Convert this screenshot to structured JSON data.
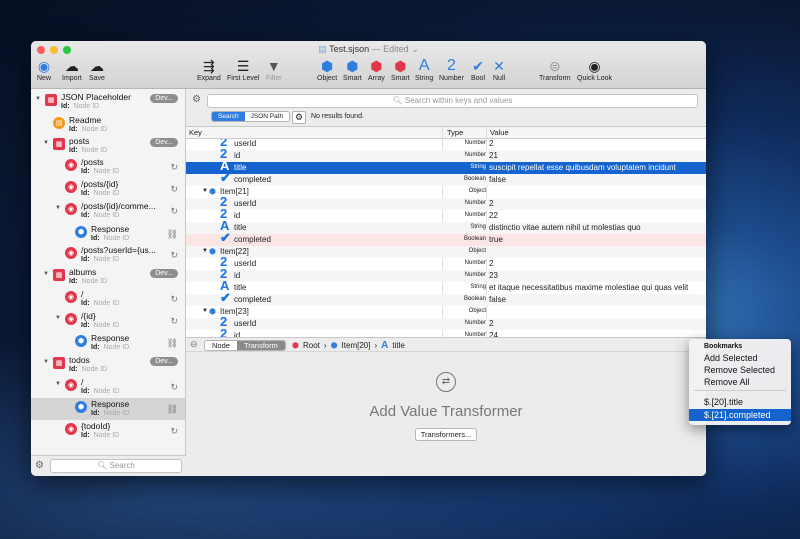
{
  "window": {
    "title": "Test.sjson",
    "status": "— Edited ⌄"
  },
  "toolbar": {
    "left": [
      {
        "label": "New",
        "icon": "new-icon"
      },
      {
        "label": "Import",
        "icon": "import-icon"
      },
      {
        "label": "Save",
        "icon": "save-icon"
      }
    ],
    "mid": [
      {
        "label": "Expand",
        "icon": "expand-icon"
      },
      {
        "label": "First Level",
        "icon": "first-level-icon"
      },
      {
        "label": "Filter",
        "icon": "filter-icon"
      }
    ],
    "types": [
      {
        "label": "Object"
      },
      {
        "label": "Smart"
      },
      {
        "label": "Array"
      },
      {
        "label": "Smart"
      },
      {
        "label": "String"
      },
      {
        "label": "Number"
      },
      {
        "label": "Bool"
      },
      {
        "label": "Null"
      }
    ],
    "right": [
      {
        "label": "Transform"
      },
      {
        "label": "Quick Look"
      }
    ]
  },
  "sidebar": {
    "id_label": "Id:",
    "id_placeholder": "Node ID",
    "dev_badge": "Dev...",
    "search_placeholder": "Search",
    "nodes": [
      {
        "name": "JSON Placeholder",
        "kind": "root"
      },
      {
        "name": "Readme",
        "kind": "readme"
      },
      {
        "name": "posts",
        "kind": "group"
      },
      {
        "name": "/posts",
        "kind": "endpoint"
      },
      {
        "name": "/posts/{id}",
        "kind": "endpoint"
      },
      {
        "name": "/posts/{id}/comme...",
        "kind": "endpoint"
      },
      {
        "name": "Response",
        "kind": "response"
      },
      {
        "name": "/posts?userId={us...",
        "kind": "endpoint"
      },
      {
        "name": "albums",
        "kind": "group"
      },
      {
        "name": "/",
        "kind": "endpoint"
      },
      {
        "name": "/{id}",
        "kind": "endpoint"
      },
      {
        "name": "Response",
        "kind": "response"
      },
      {
        "name": "todos",
        "kind": "group"
      },
      {
        "name": "/",
        "kind": "endpoint"
      },
      {
        "name": "Response",
        "kind": "response"
      },
      {
        "name": "{todoId}",
        "kind": "endpoint"
      }
    ]
  },
  "search": {
    "placeholder": "Search within keys and values",
    "modes": [
      "Search",
      "JSON Path"
    ],
    "result": "No results found."
  },
  "table": {
    "headers": {
      "key": "Key",
      "type": "Type",
      "value": "Value"
    },
    "rows": [
      {
        "key": "userId",
        "type": "Number",
        "value": "2",
        "icon": "2",
        "indent": 2
      },
      {
        "key": "id",
        "type": "Number",
        "value": "21",
        "icon": "2",
        "indent": 2
      },
      {
        "key": "title",
        "type": "String",
        "value": "suscipit repellat esse quibusdam voluptatem incidunt",
        "icon": "A",
        "indent": 2,
        "state": "sel"
      },
      {
        "key": "completed",
        "type": "Boolean",
        "value": "false",
        "icon": "✔",
        "indent": 2
      },
      {
        "key": "Item[21]",
        "type": "Object",
        "value": "",
        "icon": "obj",
        "indent": 1
      },
      {
        "key": "userId",
        "type": "Number",
        "value": "2",
        "icon": "2",
        "indent": 2
      },
      {
        "key": "id",
        "type": "Number",
        "value": "22",
        "icon": "2",
        "indent": 2
      },
      {
        "key": "title",
        "type": "String",
        "value": "distinctio vitae autem nihil ut molestias quo",
        "icon": "A",
        "indent": 2
      },
      {
        "key": "completed",
        "type": "Boolean",
        "value": "true",
        "icon": "✔",
        "indent": 2,
        "state": "err"
      },
      {
        "key": "Item[22]",
        "type": "Object",
        "value": "",
        "icon": "obj",
        "indent": 1
      },
      {
        "key": "userId",
        "type": "Number",
        "value": "2",
        "icon": "2",
        "indent": 2
      },
      {
        "key": "id",
        "type": "Number",
        "value": "23",
        "icon": "2",
        "indent": 2
      },
      {
        "key": "title",
        "type": "String",
        "value": "et itaque necessitatibus maxime molestiae qui quas velit",
        "icon": "A",
        "indent": 2
      },
      {
        "key": "completed",
        "type": "Boolean",
        "value": "false",
        "icon": "✔",
        "indent": 2
      },
      {
        "key": "Item[23]",
        "type": "Object",
        "value": "",
        "icon": "obj",
        "indent": 1
      },
      {
        "key": "userId",
        "type": "Number",
        "value": "2",
        "icon": "2",
        "indent": 2
      },
      {
        "key": "id",
        "type": "Number",
        "value": "24",
        "icon": "2",
        "indent": 2
      }
    ]
  },
  "pathbar": {
    "tabs": [
      "Node",
      "Transform"
    ],
    "crumbs": [
      "Root",
      "Item[20]",
      "title"
    ]
  },
  "transformer": {
    "title": "Add Value Transformer",
    "button": "Transformers..."
  },
  "bookmarks": {
    "heading": "Bookmarks",
    "items": [
      "Add Selected",
      "Remove Selected",
      "Remove All"
    ],
    "saved": [
      "$.[20].title",
      "$.[21].completed"
    ]
  },
  "colors": {
    "accent": "#1463cf",
    "endpoint": "#e2364b",
    "response": "#2f7de1",
    "readme": "#f29a18"
  }
}
